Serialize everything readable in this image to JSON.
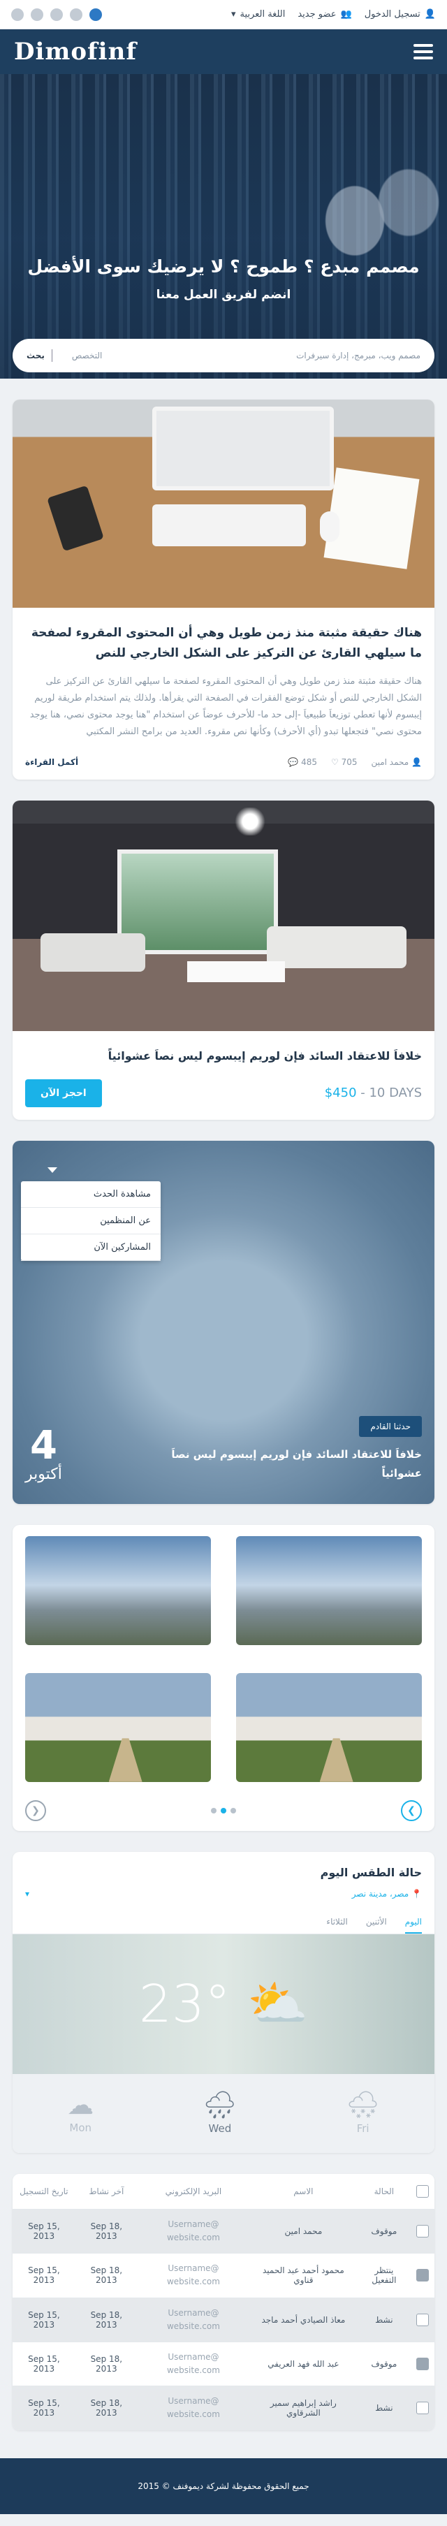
{
  "topbar": {
    "login": "تسجيل الدخول",
    "register": "عضو جديد",
    "language": "اللغة العربية"
  },
  "nav": {
    "logo": "Dimofinf"
  },
  "hero": {
    "title": "مصمم مبدع ؟ طموح ؟ لا يرضيك سوى الأفضل",
    "subtitle": "انضم لفريق العمل معنا",
    "search_placeholder": "مصمم ويب، مبرمج، إدارة سيرفرات",
    "search_tab": "التخصص",
    "search_button": "بحث"
  },
  "article": {
    "title": "هناك حقيقة مثبتة منذ زمن طويل وهي أن المحتوى المقروء لصفحة ما سيلهي القارئ عن التركيز على الشكل الخارجي للنص",
    "text": "هناك حقيقة مثبتة منذ زمن طويل وهي أن المحتوى المقروء لصفحة ما سيلهي القارئ عن التركيز على الشكل الخارجي للنص أو شكل توضع الفقرات في الصفحة التي يقرأها. ولذلك يتم استخدام طريقة لوريم إيبسوم لأنها تعطي توزيعاَ طبيعياَ -إلى حد ما- للأحرف عوضاً عن استخدام \"هنا يوجد محتوى نصي، هنا يوجد محتوى نصي\" فتجعلها تبدو (أي الأحرف) وكأنها نص مقروء. العديد من برامح النشر المكتبي",
    "author": "محمد امين",
    "likes": "705",
    "comments": "485",
    "read_more": "أكمل القراءة"
  },
  "offer": {
    "title": "خلافاَ للاعتقاد السائد فإن لوريم إيبسوم ليس نصاَ عشوائياً",
    "price": "$450",
    "duration": "- 10 DAYS",
    "book": "احجز الآن"
  },
  "event": {
    "menu": [
      "مشاهدة الحدث",
      "عن المنظمين",
      "المشاركين الآن"
    ],
    "day": "4",
    "month": "أكتوبر",
    "badge": "حدثنا القادم",
    "title": "خلافاَ للاعتقاد السائد فإن لوريم إيبسوم ليس نصاَ عشوائياً"
  },
  "weather": {
    "title": "حالة الطقس اليوم",
    "location": "مصر، مدينة نصر",
    "tabs": [
      "اليوم",
      "الأثنين",
      "الثلاثاء"
    ],
    "temp": "23°",
    "days": [
      {
        "name": "Mon",
        "icon": "cloud-icon"
      },
      {
        "name": "Wed",
        "icon": "rain-cloud-icon"
      },
      {
        "name": "Fri",
        "icon": "snow-cloud-icon"
      }
    ]
  },
  "table": {
    "headers": [
      "الحالة",
      "الاسم",
      "البريد الإلكتروني",
      "آخر نشاط",
      "تاريخ التسجيل"
    ],
    "rows": [
      {
        "status": "موقوف",
        "name": "محمد امين",
        "email": "Username@ website.com",
        "last": "Sep 18, 2013",
        "joined": "Sep 15, 2013"
      },
      {
        "status": "ينتظر التفعيل",
        "name": "محمود أحمد عبد الحميد قناوي",
        "email": "Username@ website.com",
        "last": "Sep 18, 2013",
        "joined": "Sep 15, 2013"
      },
      {
        "status": "نشط",
        "name": "معاذ الصيادي أحمد ماجد",
        "email": "Username@ website.com",
        "last": "Sep 18, 2013",
        "joined": "Sep 15, 2013"
      },
      {
        "status": "موقوف",
        "name": "عبد الله فهد العريفي",
        "email": "Username@ website.com",
        "last": "Sep 18, 2013",
        "joined": "Sep 15, 2013"
      },
      {
        "status": "نشط",
        "name": "راشد إبراهيم سمير الشرقاوي",
        "email": "Username@ website.com",
        "last": "Sep 18, 2013",
        "joined": "Sep 15, 2013"
      }
    ]
  },
  "footer": {
    "text": "جميع الحقوق محفوظة لشركة ديموفنف © 2015"
  },
  "colors": {
    "accent": "#1ab2e8",
    "navy": "#1d3b5a"
  }
}
